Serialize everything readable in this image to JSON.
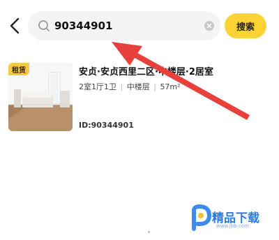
{
  "search": {
    "query": "90344901",
    "button_label": "搜索"
  },
  "listing": {
    "badge": "租赁",
    "title": "安贞·安贞西里二区·中楼层·2居室",
    "layout": "2室1厅1卫",
    "floor": "中楼层",
    "area": "57m²",
    "house_id": "ID:90344901"
  },
  "watermark": {
    "brand": "精品下载",
    "url": "www.jbb.com"
  },
  "colors": {
    "search_button": "#fdd235",
    "badge": "#f7c948",
    "annotation_arrow": "#e8403a",
    "watermark": "#2b7de6"
  }
}
